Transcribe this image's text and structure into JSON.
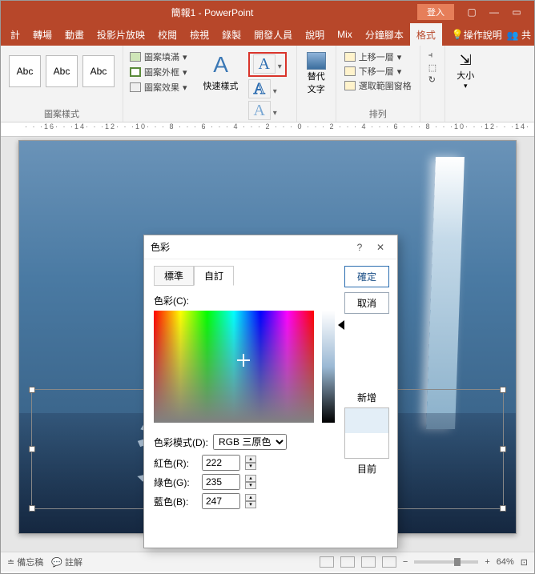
{
  "titlebar": {
    "title": "簡報1 - PowerPoint",
    "login": "登入"
  },
  "tabs": {
    "items": [
      "計",
      "轉場",
      "動畫",
      "投影片放映",
      "校閱",
      "檢視",
      "錄製",
      "開發人員",
      "說明",
      "Mix",
      "分鐘腳本",
      "格式"
    ],
    "active_index": 11,
    "help": "操作說明"
  },
  "ribbon": {
    "abc": "Abc",
    "shape_fill": "圖案填滿",
    "shape_outline": "圖案外框",
    "shape_effect": "圖案效果",
    "shape_styles_group": "圖案樣式",
    "quick_style": "快速樣式",
    "alt_text": "替代\n文字",
    "bring_forward": "上移一層",
    "send_backward": "下移一層",
    "selection_pane": "選取範圍窗格",
    "arrange_group": "排列",
    "size": "大小"
  },
  "wordart_text": "資訊圖表",
  "dialog": {
    "title": "色彩",
    "help": "?",
    "close": "✕",
    "tab_standard": "標準",
    "tab_custom": "自訂",
    "color_label": "色彩(C):",
    "mode_label": "色彩模式(D):",
    "mode_value": "RGB 三原色",
    "r_label": "紅色(R):",
    "g_label": "綠色(G):",
    "b_label": "藍色(B):",
    "r_value": "222",
    "g_value": "235",
    "b_value": "247",
    "ok": "確定",
    "cancel": "取消",
    "new": "新增",
    "current": "目前"
  },
  "status": {
    "notes": "備忘稿",
    "comments": "註解",
    "zoom": "64%",
    "plus": "+"
  }
}
